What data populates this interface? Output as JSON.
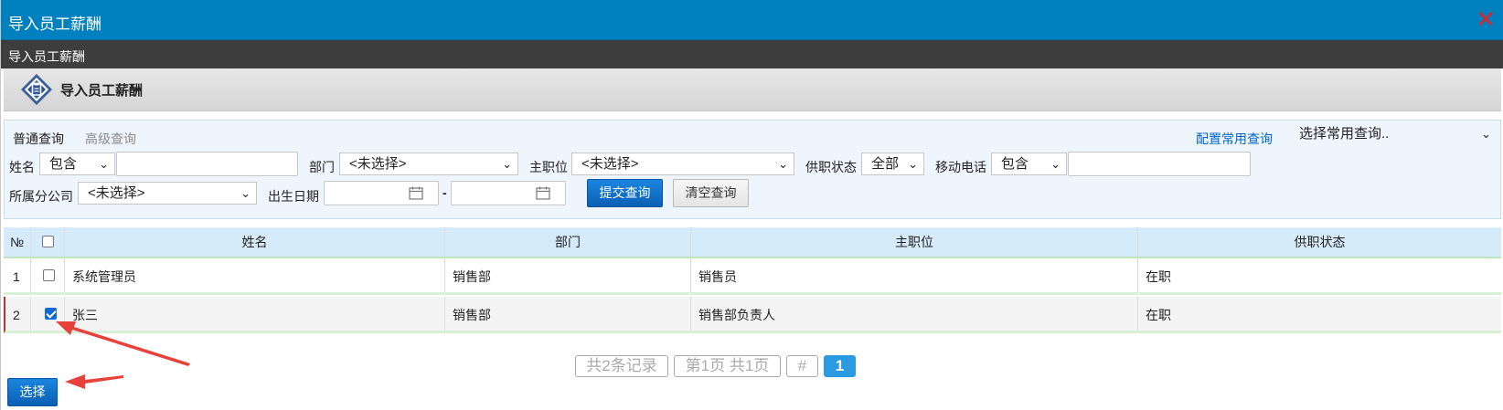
{
  "window": {
    "title": "导入员工薪酬",
    "close_glyph": "✕"
  },
  "subbar": {
    "title": "导入员工薪酬"
  },
  "page": {
    "title": "导入员工薪酬",
    "icon": "clipboard-icon"
  },
  "query": {
    "tabs": [
      "普通查询",
      "高级查询"
    ],
    "config_link": "配置常用查询",
    "common_select": "选择常用查询..",
    "name_label": "姓名",
    "name_op": "包含",
    "dept_label": "部门",
    "dept_value": "<未选择>",
    "position_label": "主职位",
    "position_value": "<未选择>",
    "status_label": "供职状态",
    "status_value": "全部",
    "mobile_label": "移动电话",
    "mobile_op": "包含",
    "branch_label": "所属分公司",
    "branch_value": "<未选择>",
    "birth_label": "出生日期",
    "range_sep": "-",
    "submit": "提交查询",
    "clear": "清空查询"
  },
  "grid": {
    "headers": [
      "№",
      "姓名",
      "部门",
      "主职位",
      "供职状态"
    ],
    "rows": [
      {
        "no": "1",
        "checked": false,
        "name": "系统管理员",
        "dept": "销售部",
        "position": "销售员",
        "status": "在职"
      },
      {
        "no": "2",
        "checked": true,
        "name": "张三",
        "dept": "销售部",
        "position": "销售部负责人",
        "status": "在职"
      }
    ]
  },
  "pager": {
    "total": "共2条记录",
    "pages": "第1页 共1页",
    "hash": "#",
    "current": "1"
  },
  "footer": {
    "select_button": "选择"
  },
  "colors": {
    "titlebar": "#0081bf",
    "subbar": "#3d3d3d",
    "accent": "#2a9be1",
    "arrow": "#e8413b"
  }
}
